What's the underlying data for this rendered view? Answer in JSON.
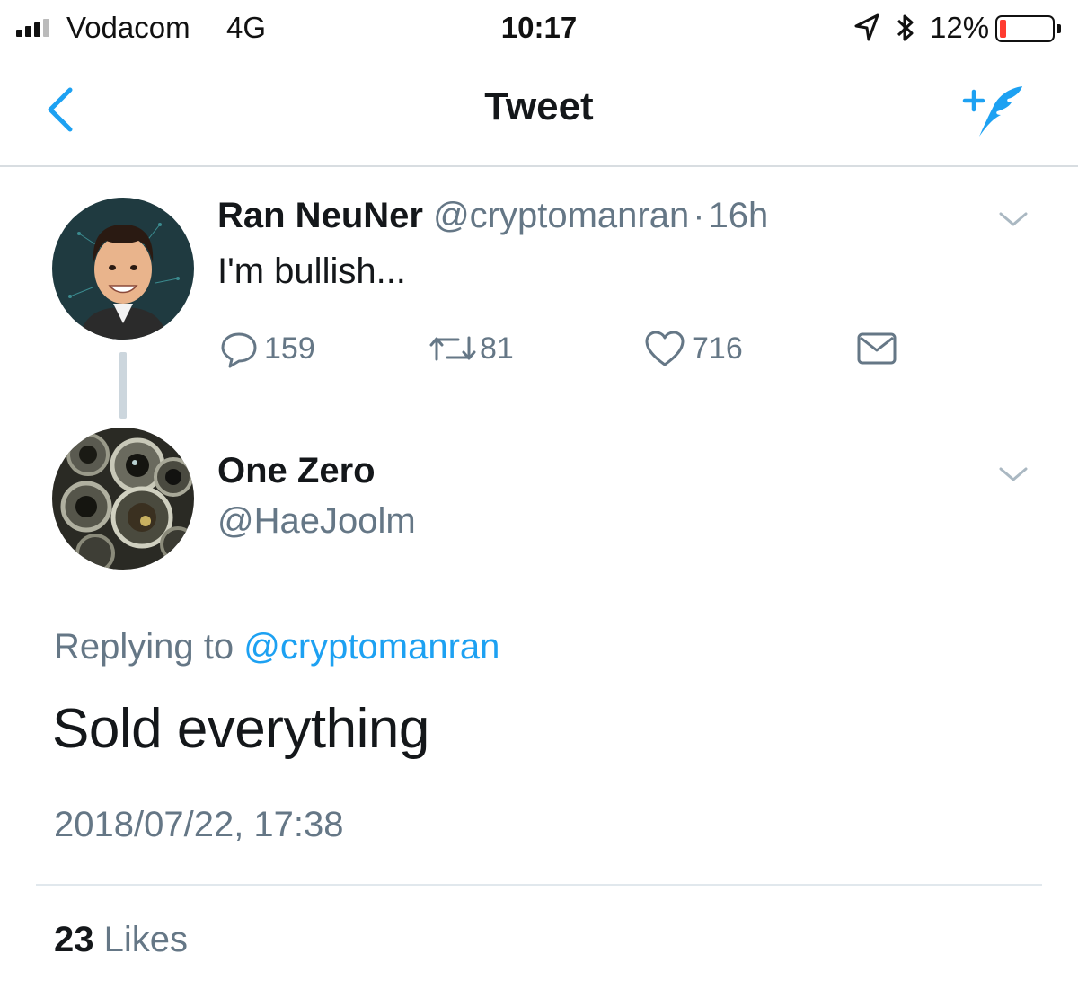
{
  "status_bar": {
    "carrier": "Vodacom",
    "network": "4G",
    "time": "10:17",
    "battery_percent": "12%",
    "battery_level": 0.12,
    "battery_color": "#ff3b30",
    "icons": [
      "signal-icon",
      "location-icon",
      "bluetooth-icon",
      "battery-icon"
    ]
  },
  "nav": {
    "title": "Tweet",
    "back_icon": "chevron-left-icon",
    "compose_icon": "compose-tweet-icon",
    "accent_color": "#1da1f2"
  },
  "parent_tweet": {
    "name": "Ran NeuNer",
    "handle": "@cryptomanran",
    "separator": "·",
    "time": "16h",
    "text": "I'm bullish...",
    "actions": {
      "replies": "159",
      "retweets": "81",
      "likes": "716"
    }
  },
  "main_tweet": {
    "name": "One Zero",
    "handle": "@HaeJoolm",
    "replying_prefix": "Replying to",
    "replying_to": "@cryptomanran",
    "text": "Sold everything",
    "timestamp": "2018/07/22, 17:38",
    "likes_count": "23",
    "likes_label": "Likes"
  }
}
